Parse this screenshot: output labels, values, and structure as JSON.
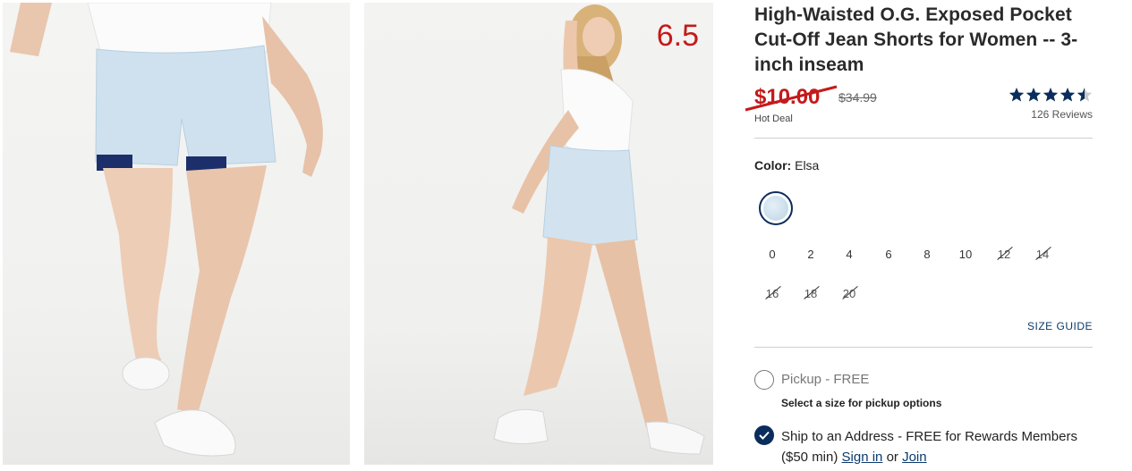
{
  "overlay_number": "6.5",
  "product": {
    "title": "High-Waisted O.G. Exposed Pocket Cut-Off Jean Shorts for Women -- 3-inch inseam",
    "sale_price": "$10.00",
    "original_price": "$34.99",
    "deal_label": "Hot Deal",
    "rating_value": 4.5,
    "rating_max": 5,
    "reviews_text": "126 Reviews"
  },
  "color": {
    "label": "Color:",
    "value": "Elsa",
    "swatch_color": "#cfe0ed"
  },
  "sizes": [
    {
      "label": "0",
      "available": true
    },
    {
      "label": "2",
      "available": true
    },
    {
      "label": "4",
      "available": true
    },
    {
      "label": "6",
      "available": true
    },
    {
      "label": "8",
      "available": true
    },
    {
      "label": "10",
      "available": true
    },
    {
      "label": "12",
      "available": false
    },
    {
      "label": "14",
      "available": false
    },
    {
      "label": "16",
      "available": false
    },
    {
      "label": "18",
      "available": false
    },
    {
      "label": "20",
      "available": false
    }
  ],
  "size_guide_label": "SIZE GUIDE",
  "fulfillment": {
    "pickup_label": "Pickup - FREE",
    "pickup_sub": "Select a size for pickup options",
    "ship_label_prefix": "Ship to an Address - FREE for Rewards Members ($50 min)",
    "sign_in_label": "Sign in",
    "or_label": "or",
    "join_label": "Join"
  },
  "colors": {
    "sale_red": "#c41a1a",
    "navy": "#0b2d5c",
    "link_blue": "#0b3a6d"
  }
}
